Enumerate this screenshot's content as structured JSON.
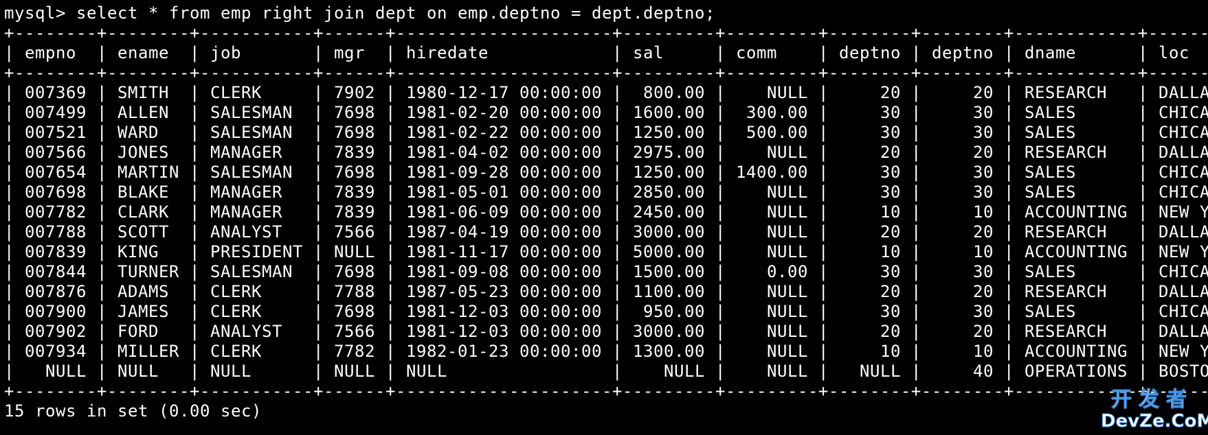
{
  "terminal": {
    "prompt": "mysql>",
    "command": "select * from emp right join dept on emp.deptno = dept.deptno;",
    "columns": [
      "empno",
      "ename",
      "job",
      "mgr",
      "hiredate",
      "sal",
      "comm",
      "deptno",
      "deptno",
      "dname",
      "loc"
    ],
    "rows": [
      [
        "007369",
        "SMITH",
        "CLERK",
        "7902",
        "1980-12-17 00:00:00",
        "800.00",
        "NULL",
        "20",
        "20",
        "RESEARCH",
        "DALLAS"
      ],
      [
        "007499",
        "ALLEN",
        "SALESMAN",
        "7698",
        "1981-02-20 00:00:00",
        "1600.00",
        "300.00",
        "30",
        "30",
        "SALES",
        "CHICAGO"
      ],
      [
        "007521",
        "WARD",
        "SALESMAN",
        "7698",
        "1981-02-22 00:00:00",
        "1250.00",
        "500.00",
        "30",
        "30",
        "SALES",
        "CHICAGO"
      ],
      [
        "007566",
        "JONES",
        "MANAGER",
        "7839",
        "1981-04-02 00:00:00",
        "2975.00",
        "NULL",
        "20",
        "20",
        "RESEARCH",
        "DALLAS"
      ],
      [
        "007654",
        "MARTIN",
        "SALESMAN",
        "7698",
        "1981-09-28 00:00:00",
        "1250.00",
        "1400.00",
        "30",
        "30",
        "SALES",
        "CHICAGO"
      ],
      [
        "007698",
        "BLAKE",
        "MANAGER",
        "7839",
        "1981-05-01 00:00:00",
        "2850.00",
        "NULL",
        "30",
        "30",
        "SALES",
        "CHICAGO"
      ],
      [
        "007782",
        "CLARK",
        "MANAGER",
        "7839",
        "1981-06-09 00:00:00",
        "2450.00",
        "NULL",
        "10",
        "10",
        "ACCOUNTING",
        "NEW YORK"
      ],
      [
        "007788",
        "SCOTT",
        "ANALYST",
        "7566",
        "1987-04-19 00:00:00",
        "3000.00",
        "NULL",
        "20",
        "20",
        "RESEARCH",
        "DALLAS"
      ],
      [
        "007839",
        "KING",
        "PRESIDENT",
        "NULL",
        "1981-11-17 00:00:00",
        "5000.00",
        "NULL",
        "10",
        "10",
        "ACCOUNTING",
        "NEW YORK"
      ],
      [
        "007844",
        "TURNER",
        "SALESMAN",
        "7698",
        "1981-09-08 00:00:00",
        "1500.00",
        "0.00",
        "30",
        "30",
        "SALES",
        "CHICAGO"
      ],
      [
        "007876",
        "ADAMS",
        "CLERK",
        "7788",
        "1987-05-23 00:00:00",
        "1100.00",
        "NULL",
        "20",
        "20",
        "RESEARCH",
        "DALLAS"
      ],
      [
        "007900",
        "JAMES",
        "CLERK",
        "7698",
        "1981-12-03 00:00:00",
        "950.00",
        "NULL",
        "30",
        "30",
        "SALES",
        "CHICAGO"
      ],
      [
        "007902",
        "FORD",
        "ANALYST",
        "7566",
        "1981-12-03 00:00:00",
        "3000.00",
        "NULL",
        "20",
        "20",
        "RESEARCH",
        "DALLAS"
      ],
      [
        "007934",
        "MILLER",
        "CLERK",
        "7782",
        "1982-01-23 00:00:00",
        "1300.00",
        "NULL",
        "10",
        "10",
        "ACCOUNTING",
        "NEW YORK"
      ],
      [
        "NULL",
        "NULL",
        "NULL",
        "NULL",
        "NULL",
        "NULL",
        "NULL",
        "NULL",
        "40",
        "OPERATIONS",
        "BOSTON"
      ]
    ],
    "status": "15 rows in set (0.00 sec)"
  },
  "watermark": {
    "top": "开发者",
    "bottom": "DevZe.CoM"
  },
  "colors": {
    "background": "#000000",
    "text": "#ffffff",
    "watermark_outline": "#3f8fe0"
  }
}
